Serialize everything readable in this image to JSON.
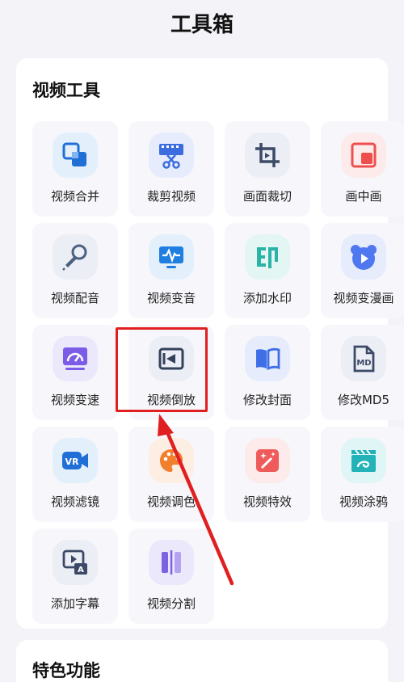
{
  "header": {
    "title": "工具箱"
  },
  "sections": {
    "video_tools": {
      "title": "视频工具"
    },
    "features": {
      "title": "特色功能"
    }
  },
  "tools": [
    {
      "label": "视频合并",
      "icon": "merge-icon",
      "bg": "#e3f0fc",
      "color": "#1f6fd6"
    },
    {
      "label": "裁剪视频",
      "icon": "film-scissors-icon",
      "bg": "#e6ecfb",
      "color": "#3b6de0"
    },
    {
      "label": "画面裁切",
      "icon": "crop-icon",
      "bg": "#eceef6",
      "color": "#3c4a66"
    },
    {
      "label": "画中画",
      "icon": "picture-in-picture-icon",
      "bg": "#fdeaea",
      "color": "#ef4e4e"
    },
    {
      "label": "视频配音",
      "icon": "microphone-icon",
      "bg": "#eceef6",
      "color": "#4a6280"
    },
    {
      "label": "视频变音",
      "icon": "waveform-monitor-icon",
      "bg": "#e3f0fc",
      "color": "#1f7fe0"
    },
    {
      "label": "添加水印",
      "icon": "watermark-icon",
      "bg": "#e4f6f4",
      "color": "#2bb3a8"
    },
    {
      "label": "视频变漫画",
      "icon": "bear-play-icon",
      "bg": "#e6ecfb",
      "color": "#4f78f0"
    },
    {
      "label": "视频变速",
      "icon": "speedometer-icon",
      "bg": "#ece8fb",
      "color": "#7a5ce6"
    },
    {
      "label": "视频倒放",
      "icon": "reverse-play-icon",
      "bg": "#eceef6",
      "color": "#34415a"
    },
    {
      "label": "修改封面",
      "icon": "book-cover-icon",
      "bg": "#e6ecfb",
      "color": "#3f6fe6"
    },
    {
      "label": "修改MD5",
      "icon": "md5-file-icon",
      "bg": "#eceef6",
      "color": "#3c4a66"
    },
    {
      "label": "视频滤镜",
      "icon": "vr-camera-icon",
      "bg": "#e3f0fc",
      "color": "#1f6fd6"
    },
    {
      "label": "视频调色",
      "icon": "palette-icon",
      "bg": "#fdeee4",
      "color": "#f0802e"
    },
    {
      "label": "视频特效",
      "icon": "magic-wand-icon",
      "bg": "#fdeaea",
      "color": "#ef5a5a"
    },
    {
      "label": "视频涂鸦",
      "icon": "clapper-doodle-icon",
      "bg": "#e0f5f5",
      "color": "#22b2b8"
    },
    {
      "label": "添加字幕",
      "icon": "subtitle-icon",
      "bg": "#eceef6",
      "color": "#3c4a66"
    },
    {
      "label": "视频分割",
      "icon": "split-icon",
      "bg": "#ece8fb",
      "color": "#7c62e2"
    }
  ],
  "annotation": {
    "highlight_color": "#e02020",
    "highlighted_tool": "视频倒放"
  }
}
